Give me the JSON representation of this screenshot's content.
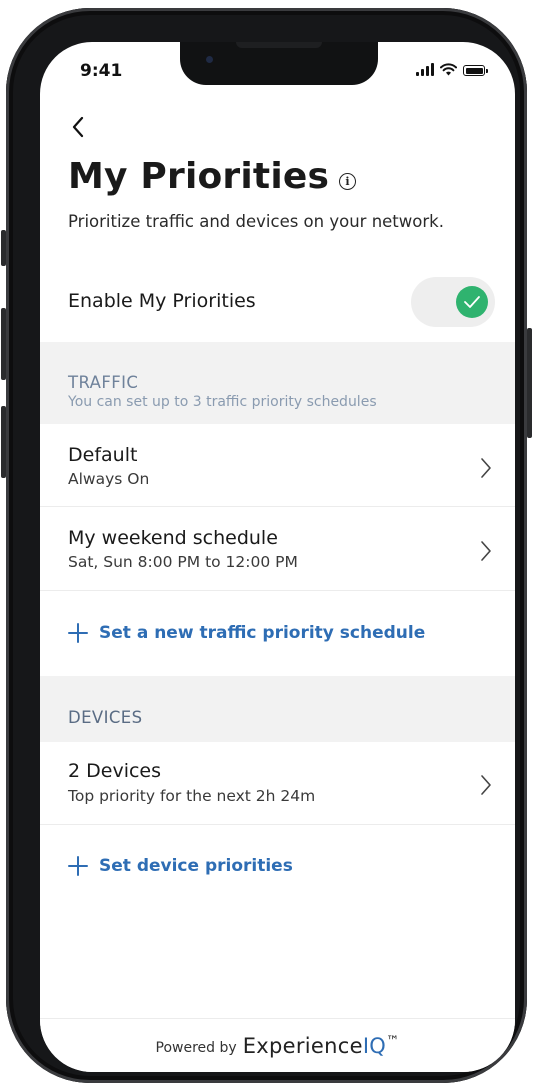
{
  "status_bar": {
    "time": "9:41"
  },
  "header": {
    "title": "My Priorities",
    "subtitle": "Prioritize traffic and devices on your network."
  },
  "enable": {
    "label": "Enable My Priorities",
    "enabled": true
  },
  "traffic": {
    "heading": "TRAFFIC",
    "note": "You can set up to 3 traffic priority schedules",
    "items": [
      {
        "title": "Default",
        "detail": "Always On"
      },
      {
        "title": "My weekend schedule",
        "detail": "Sat, Sun 8:00 PM to 12:00 PM"
      }
    ],
    "add_label": "Set a new traffic priority schedule"
  },
  "devices": {
    "heading": "DEVICES",
    "items": [
      {
        "title": "2 Devices",
        "detail": "Top priority for the next 2h 24m"
      }
    ],
    "add_label": "Set device priorities"
  },
  "footer": {
    "powered_by": "Powered by",
    "brand_main": "Experience",
    "brand_accent": "IQ",
    "brand_tm": "™"
  },
  "colors": {
    "accent": "#2e6db4",
    "toggle_on": "#2fb36f",
    "section_bg": "#f2f2f2",
    "traffic_heading": "#6f829b",
    "devices_heading": "#5a6c84"
  }
}
